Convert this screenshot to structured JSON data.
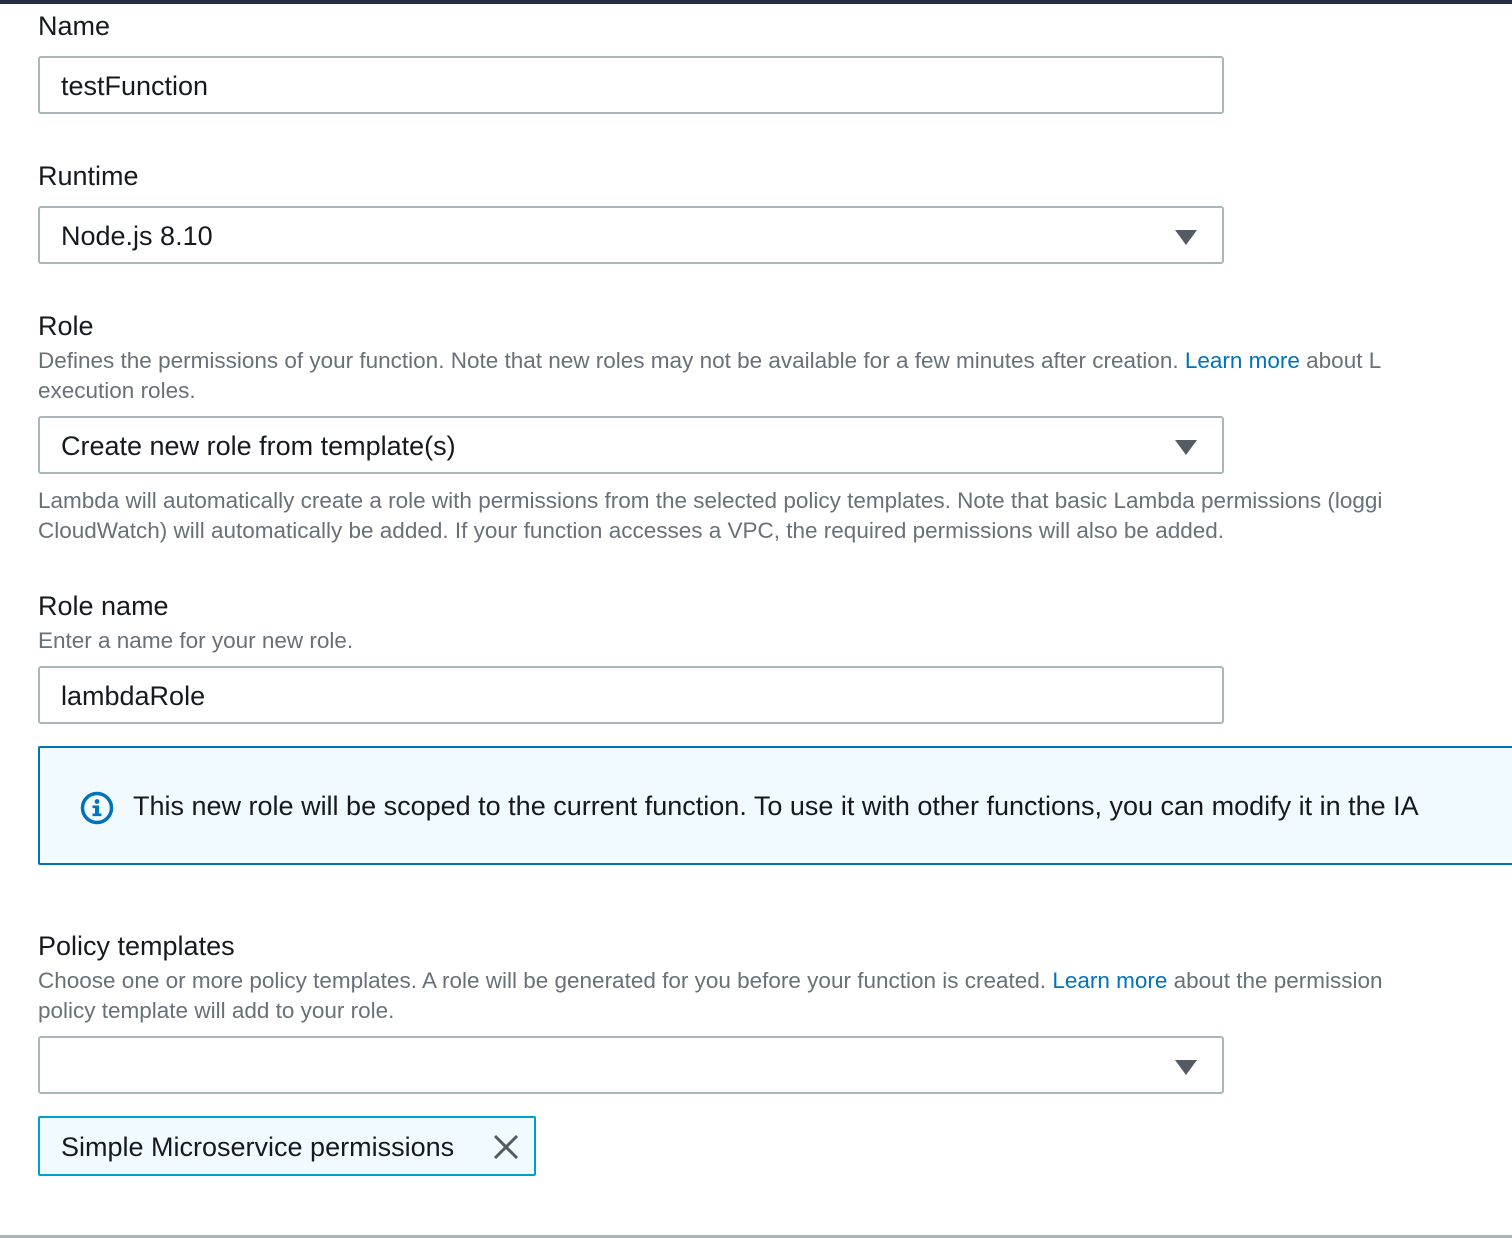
{
  "name_field": {
    "label": "Name",
    "value": "testFunction"
  },
  "runtime_field": {
    "label": "Runtime",
    "value": "Node.js 8.10",
    "icon": "chevron-down-icon"
  },
  "role_field": {
    "label": "Role",
    "description_prefix": "Defines the permissions of your function. Note that new roles may not be available for a few minutes after creation. ",
    "description_link": "Learn more",
    "description_suffix": " about L",
    "description_line2": "execution roles.",
    "value": "Create new role from template(s)",
    "help_line1": "Lambda will automatically create a role with permissions from the selected policy templates. Note that basic Lambda permissions (loggi",
    "help_line2": "CloudWatch) will automatically be added. If your function accesses a VPC, the required permissions will also be added."
  },
  "role_name_field": {
    "label": "Role name",
    "description": "Enter a name for your new role.",
    "value": "lambdaRole"
  },
  "info_alert": {
    "icon": "info-icon",
    "text": "This new role will be scoped to the current function. To use it with other functions, you can modify it in the IA"
  },
  "policy_templates_field": {
    "label": "Policy templates",
    "description_prefix": "Choose one or more policy templates. A role will be generated for you before your function is created. ",
    "description_link": "Learn more",
    "description_suffix": " about the permission",
    "description_line2": "policy template will add to your role.",
    "value": "",
    "selected_tokens": [
      {
        "label": "Simple Microservice permissions",
        "remove_icon": "close-icon"
      }
    ]
  },
  "colors": {
    "link": "#0073bb",
    "info_border": "#0073bb",
    "info_background": "#f1faff",
    "token_border": "#00a1c9",
    "header_bar": "#232f3e"
  }
}
